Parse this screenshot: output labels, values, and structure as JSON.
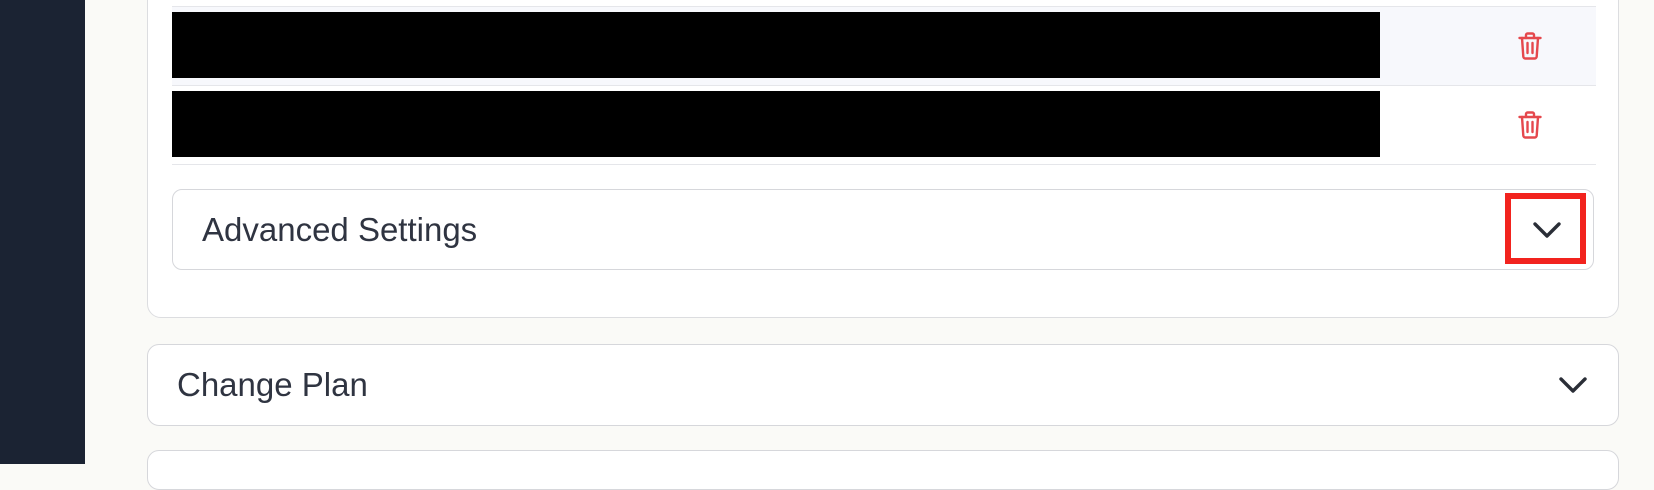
{
  "users_list": {
    "rows": [
      {
        "value": "",
        "delete_icon": "trash-icon"
      },
      {
        "value": "",
        "delete_icon": "trash-icon"
      }
    ]
  },
  "advanced_settings": {
    "title": "Advanced Settings",
    "toggle_icon": "chevron-down-icon",
    "expanded": false
  },
  "change_plan": {
    "title": "Change Plan",
    "toggle_icon": "chevron-down-icon",
    "expanded": false
  },
  "colors": {
    "sidebar": "#1b2333",
    "delete": "#e5484d",
    "highlight": "#f2231e",
    "text": "#2f3441"
  }
}
